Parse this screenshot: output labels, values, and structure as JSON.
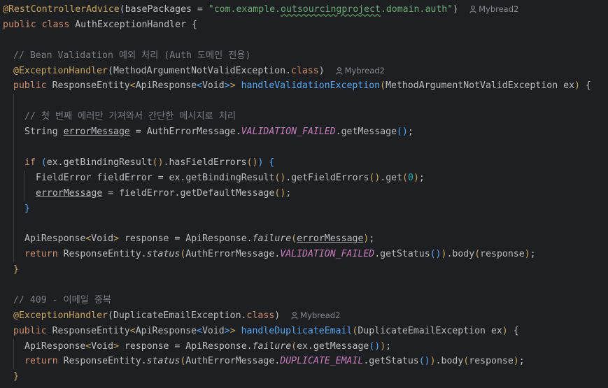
{
  "code": {
    "class_annotation": "@RestControllerAdvice",
    "base_packages_param": "basePackages = ",
    "base_packages_prefix": "\"com.example.",
    "base_packages_word": "outsourcingproject",
    "base_packages_suffix": ".domain.auth\"",
    "class_decl_kw": "public class ",
    "class_name": "AuthExceptionHandler {",
    "comment_bean": "// Bean Validation 예외 처리 (Auth 도메인 전용)",
    "exception_handler_annotation": "@ExceptionHandler",
    "arg_invalid_exception": "MethodArgumentNotValidException.",
    "class_kw": "class",
    "public_kw": "public ",
    "response_entity": "ResponseEntity",
    "api_response": "ApiResponse",
    "void_type": "Void",
    "method_validation": "handleValidationException",
    "param_validation": "MethodArgumentNotValidException ex",
    "comment_first_error": "// 첫 번째 에러만 가져와서 간단한 메시지로 처리",
    "string_type": "String ",
    "error_message_var": "errorMessage",
    "auth_error_message": "AuthErrorMessage.",
    "validation_failed": "VALIDATION_FAILED",
    "get_message": "getMessage",
    "if_kw": "if ",
    "ex_get_binding": "ex.getBindingResult",
    "has_field_errors": ".hasFieldErrors",
    "field_error_decl": "FieldError fieldError = ex.getBindingResult",
    "get_field_errors": ".getFieldErrors",
    "get_call": ".get",
    "zero": "0",
    "assign": " = ",
    "field_error_get_default": "fieldError.getDefaultMessage",
    "close_brace": "}",
    "response_var": " response = ",
    "api_response_dot": "ApiResponse.",
    "failure": "failure",
    "return_kw": "return ",
    "response_entity_dot": "ResponseEntity.",
    "status": "status",
    "get_status": ".getStatus",
    "body": ".body",
    "response_arg": "response",
    "comment_409": "// 409 - 이메일 중복",
    "duplicate_exception": "DuplicateEmailException.",
    "method_duplicate": "handleDuplicateEmail",
    "param_duplicate": "DuplicateEmailException ex",
    "ex_get_message": "ex.getMessage",
    "duplicate_email": "DUPLICATE_EMAIL"
  },
  "author_hints": {
    "class_author": "Mybread2",
    "validation_author": "Mybread2",
    "duplicate_author": "Mybread2"
  },
  "icons": [
    "person-icon"
  ],
  "colors": {
    "background": "#1e1f22",
    "keyword": "#cf8e6d",
    "annotation": "#c7a65d",
    "string": "#6aab73",
    "comment": "#7a7e85",
    "method": "#56a8f5",
    "constant": "#c77dbb",
    "number": "#2aacb8",
    "text": "#bcbec4"
  }
}
